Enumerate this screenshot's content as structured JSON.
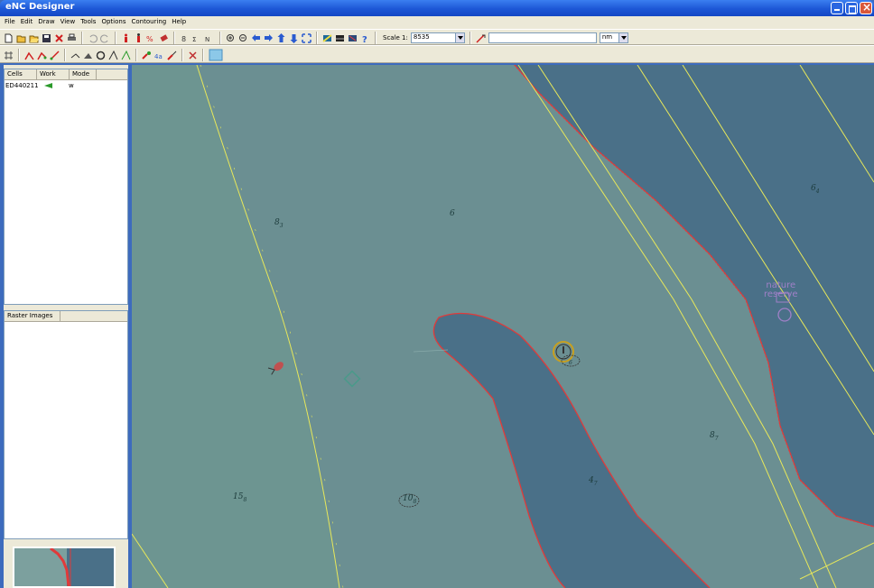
{
  "window": {
    "title": "eNC Designer"
  },
  "menu": [
    "File",
    "Edit",
    "Draw",
    "View",
    "Tools",
    "Options",
    "Contouring",
    "Help"
  ],
  "toolbar": {
    "scale_label": "Scale 1:",
    "scale_value": "8535",
    "unit_value": "nm",
    "icons_row1": [
      "new-icon",
      "open-icon",
      "open-folder-icon",
      "save-icon",
      "delete-icon",
      "print-icon",
      "undo-icon",
      "redo-icon",
      "info-icon",
      "depth-info-icon",
      "depth-percent-icon",
      "eraser-icon",
      "sounding-icon",
      "sounding-list-icon",
      "sounding-n-icon",
      "zoom-in-icon",
      "zoom-out-icon",
      "pan-left-icon",
      "pan-right-icon",
      "pan-up-icon",
      "pan-down-icon",
      "zoom-extent-icon",
      "display-a-icon",
      "display-b-icon",
      "display-c-icon",
      "help-icon"
    ],
    "icons_row2": [
      "grid-icon",
      "line-edit-icon",
      "line-add-icon",
      "line-draw-icon",
      "point-move-icon",
      "point-add-icon",
      "circle-icon",
      "area-a-icon",
      "area-b-icon",
      "symbol-icon",
      "label-icon",
      "brush-icon",
      "cut-icon",
      "raster-icon"
    ]
  },
  "cells_panel": {
    "headers": [
      "Cells",
      "Work",
      "Mode"
    ],
    "rows": [
      {
        "name": "ED440211",
        "mode": "w"
      }
    ]
  },
  "raster_panel": {
    "header": "Raster Images"
  },
  "map": {
    "labels": [
      {
        "main": "8",
        "sub": "3"
      },
      {
        "main": "6",
        "sub": ""
      },
      {
        "main": "6",
        "sub": "4"
      },
      {
        "main": "15",
        "sub": "8"
      },
      {
        "main": "10",
        "sub": "8"
      },
      {
        "main": "4",
        "sub": "7"
      },
      {
        "main": "8",
        "sub": "7"
      },
      {
        "main": "",
        "sub": "6"
      }
    ],
    "nature_line1": "nature",
    "nature_line2": "reserve",
    "colors": {
      "shallow": "#6b8f92",
      "deep": "#4a7088",
      "contour_red": "#e03a3a",
      "line_yellow": "#e8e85a"
    }
  }
}
